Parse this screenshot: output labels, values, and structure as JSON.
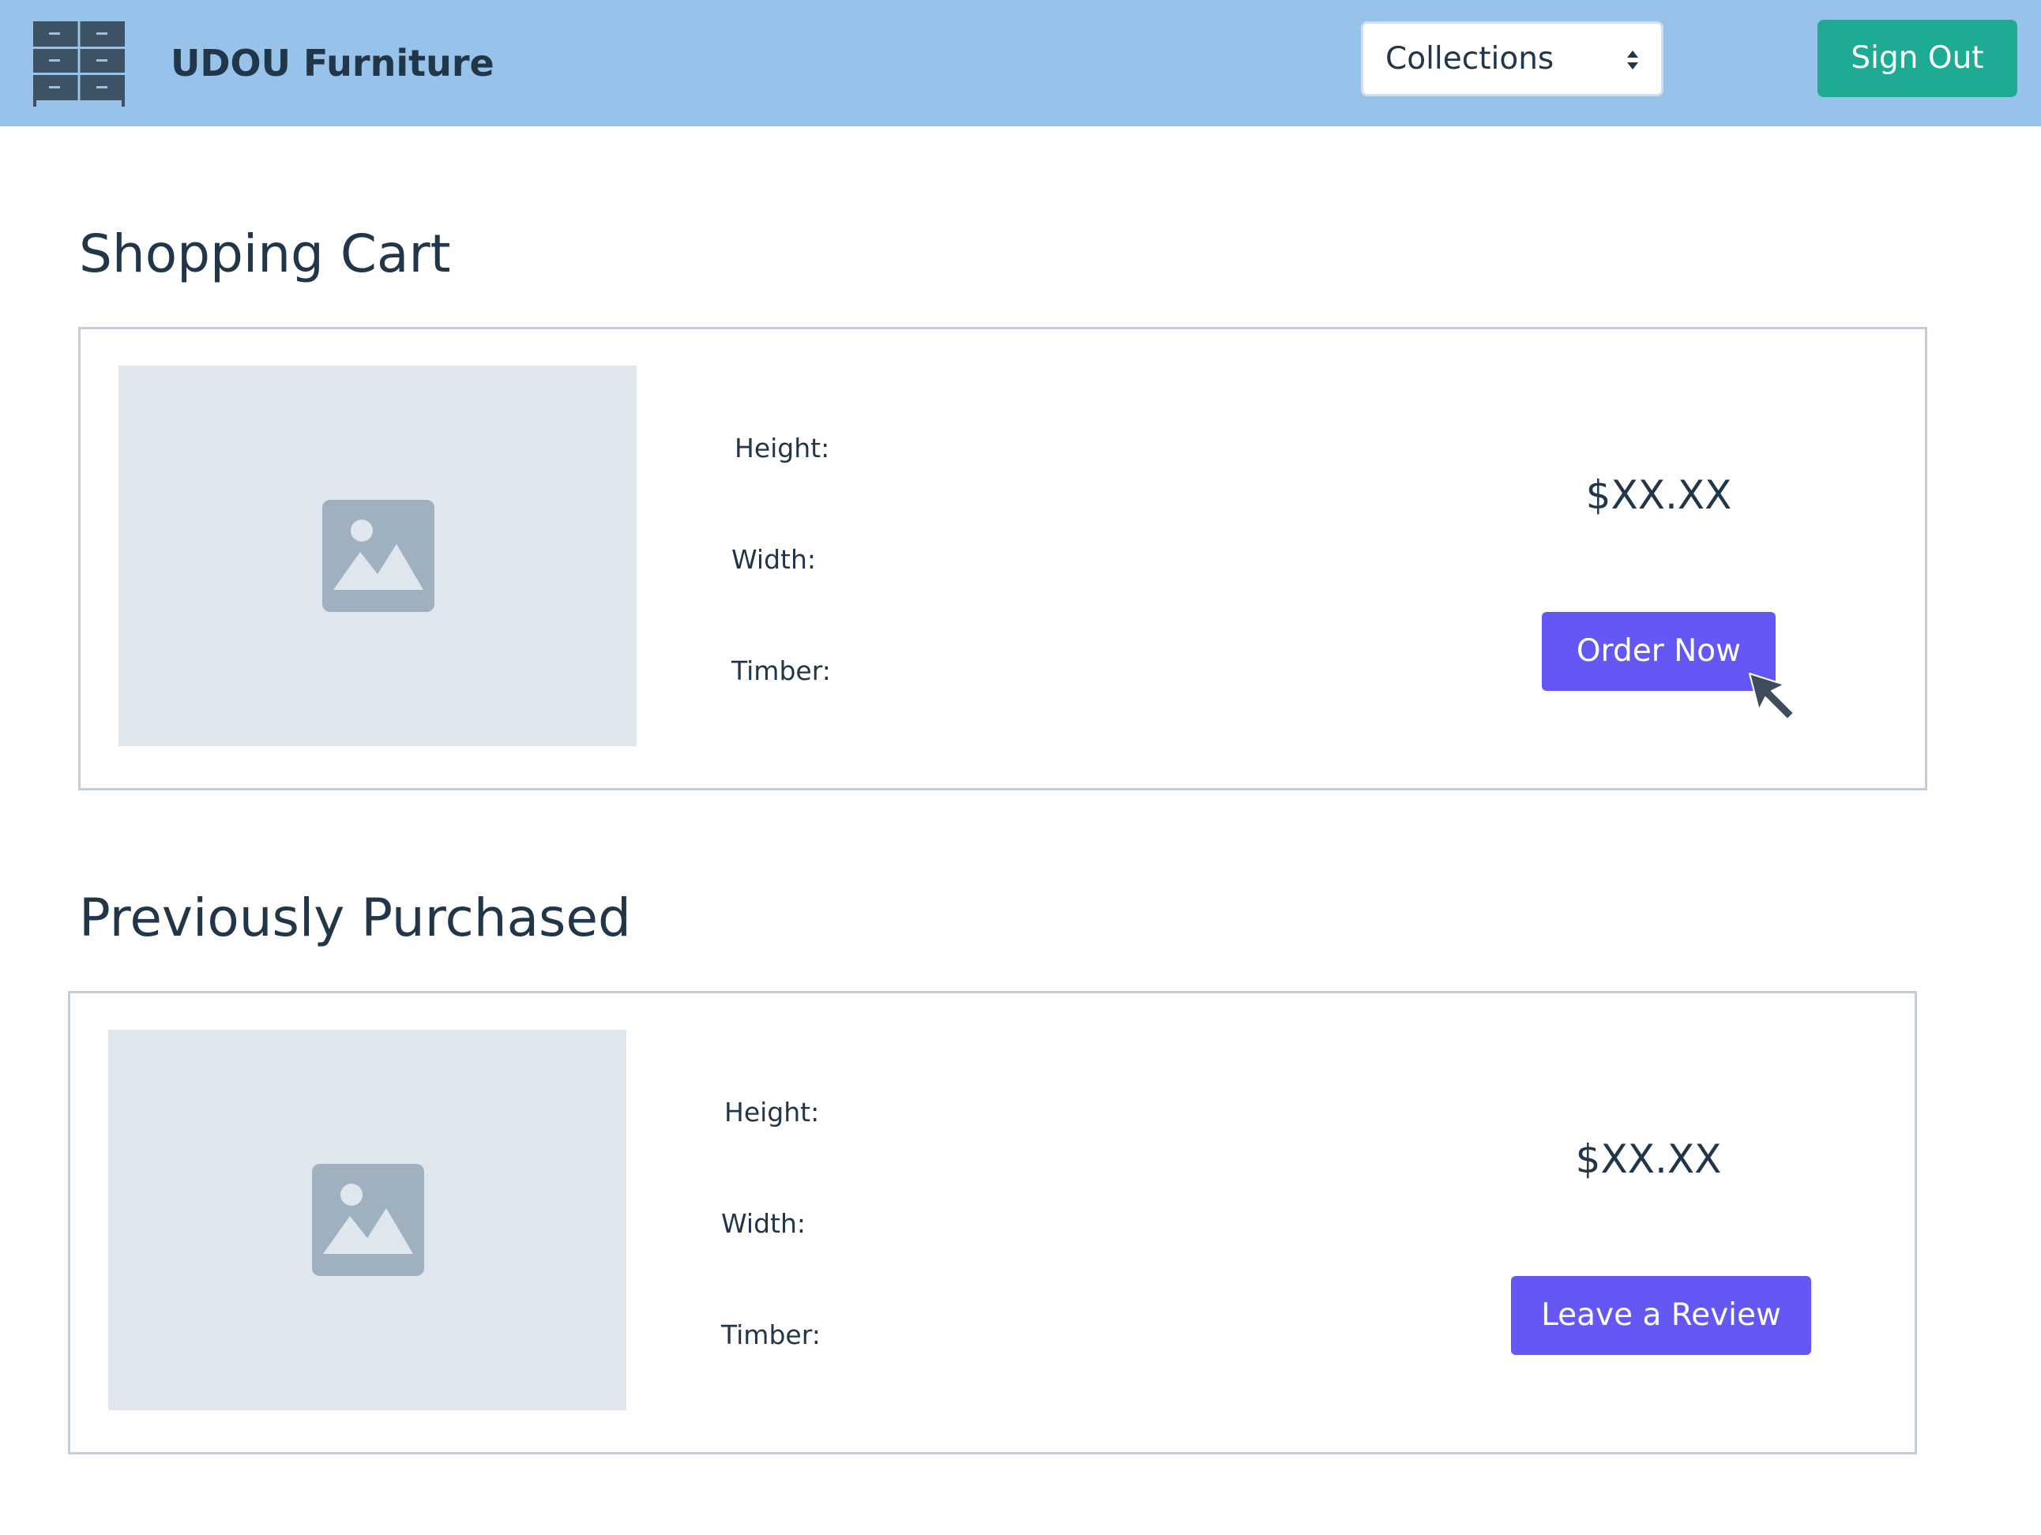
{
  "header": {
    "logo_icon": "cabinet-drawers-icon",
    "brand": "UDOU Furniture",
    "collections_select": {
      "selected": "Collections",
      "arrows_icon": "select-updown-icon"
    },
    "sign_out_label": "Sign Out"
  },
  "colors": {
    "header_bg": "#97c3eb",
    "sign_out_bg": "#1eab94",
    "primary_button": "#6458f5",
    "text": "#22364a",
    "placeholder_bg": "#e0e6ee",
    "placeholder_icon": "#9fb0be"
  },
  "shopping_cart": {
    "title": "Shopping Cart",
    "item": {
      "image_icon": "image-placeholder-icon",
      "height_label": "Height:",
      "width_label": "Width:",
      "timber_label": "Timber:",
      "price": "$XX.XX",
      "action_label": "Order Now"
    }
  },
  "previously_purchased": {
    "title": "Previously Purchased",
    "item": {
      "image_icon": "image-placeholder-icon",
      "height_label": "Height:",
      "width_label": "Width:",
      "timber_label": "Timber:",
      "price": "$XX.XX",
      "action_label": "Leave a Review"
    }
  },
  "cursor_icon": "mouse-pointer-icon"
}
